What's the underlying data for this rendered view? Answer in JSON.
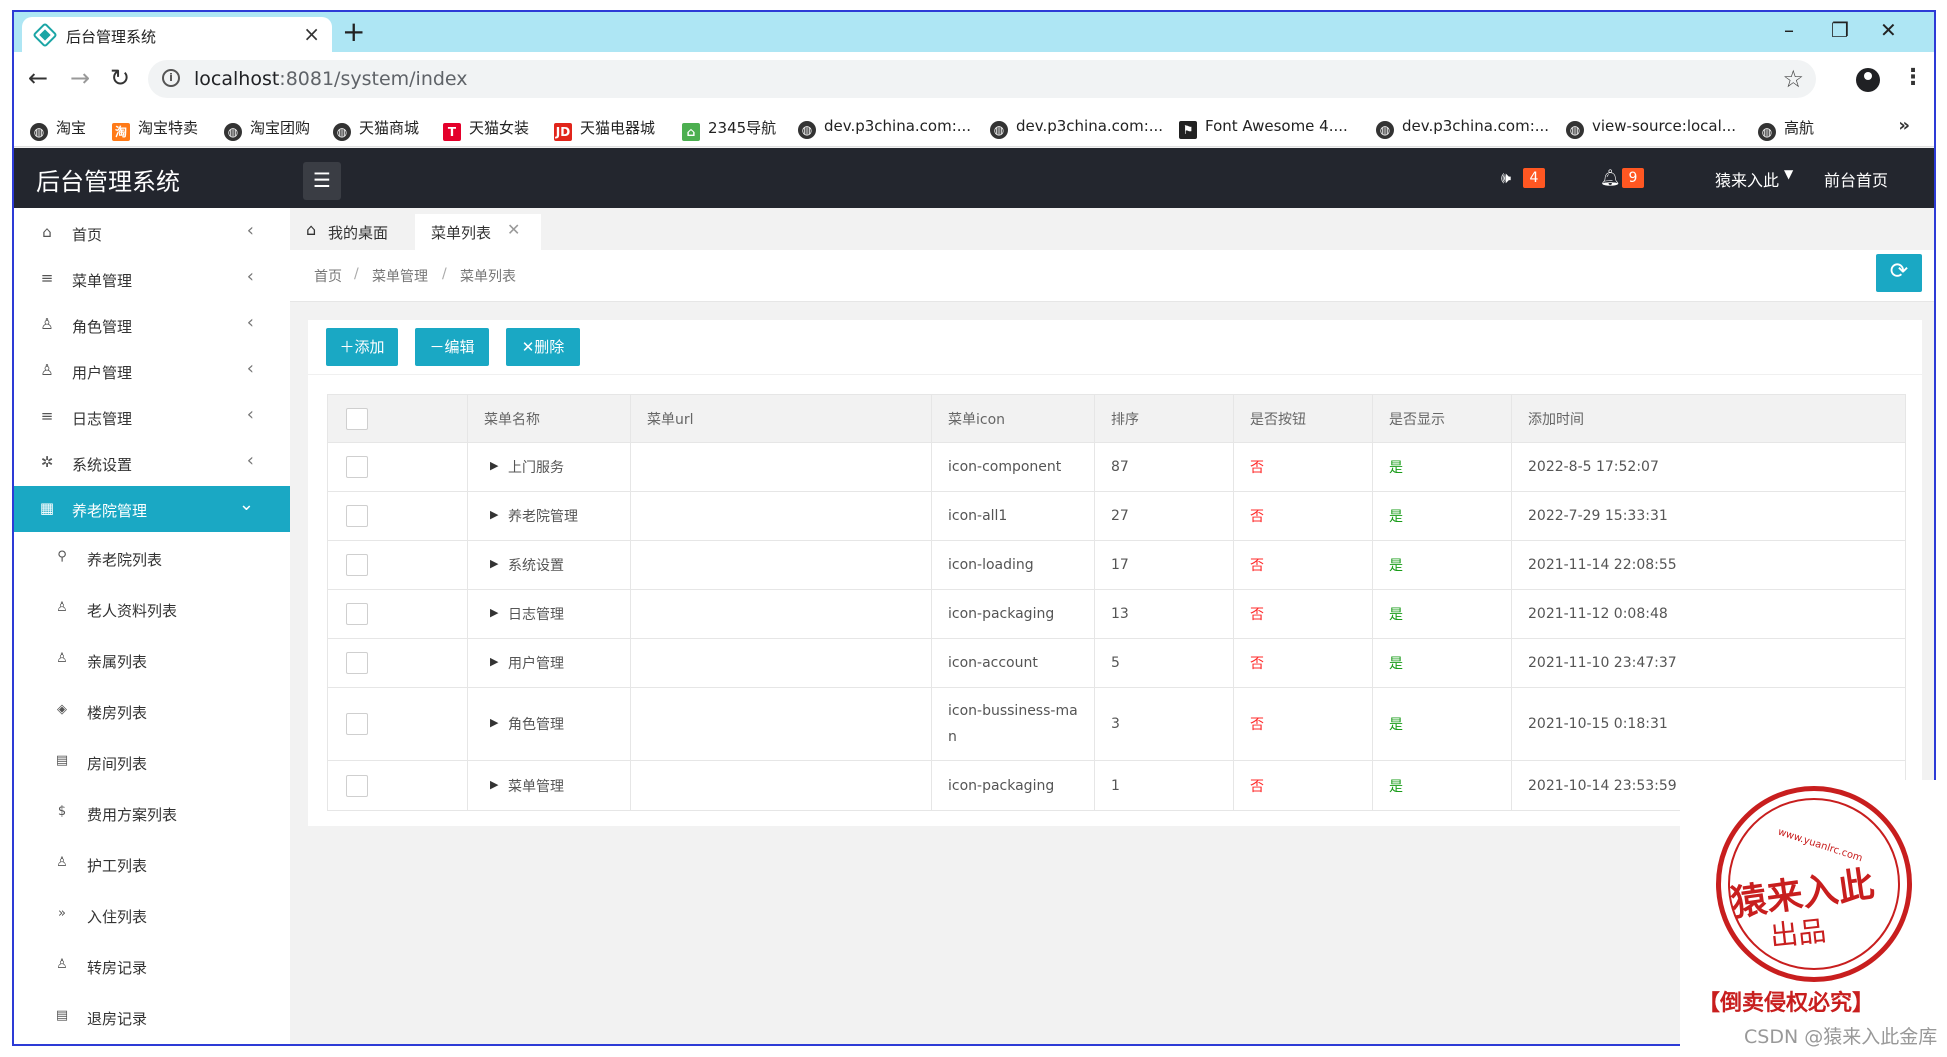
{
  "browser": {
    "tab_title": "后台管理系统",
    "tab_close": "×",
    "new_tab": "+",
    "url_host": "localhost",
    "url_rest": ":8081/system/index",
    "window_controls": [
      "–",
      "❐",
      "✕"
    ],
    "bookmarks": [
      {
        "label": "淘宝",
        "icon": "globe-icon"
      },
      {
        "label": "淘宝特卖",
        "icon": "taobao-sale-icon"
      },
      {
        "label": "淘宝团购",
        "icon": "globe-icon"
      },
      {
        "label": "天猫商城",
        "icon": "globe-icon"
      },
      {
        "label": "天猫女装",
        "icon": "tmall-icon"
      },
      {
        "label": "天猫电器城",
        "icon": "jd-icon"
      },
      {
        "label": "2345导航",
        "icon": "2345-icon"
      },
      {
        "label": "dev.p3china.com:...",
        "icon": "globe-icon"
      },
      {
        "label": "dev.p3china.com:...",
        "icon": "globe-icon"
      },
      {
        "label": "Font Awesome 4....",
        "icon": "flag-icon"
      },
      {
        "label": "dev.p3china.com:...",
        "icon": "globe-icon"
      },
      {
        "label": "view-source:local...",
        "icon": "globe-icon"
      },
      {
        "label": "高航",
        "icon": "globe-icon"
      }
    ],
    "bookmarks_more": "»"
  },
  "header": {
    "title": "后台管理系统",
    "notice_badge": "4",
    "bell_badge": "9",
    "user_name": "猿来入此",
    "front_link": "前台首页"
  },
  "sidebar": {
    "items": [
      {
        "label": "首页",
        "icon": "home-icon"
      },
      {
        "label": "菜单管理",
        "icon": "list-icon"
      },
      {
        "label": "角色管理",
        "icon": "user-icon"
      },
      {
        "label": "用户管理",
        "icon": "user-icon"
      },
      {
        "label": "日志管理",
        "icon": "list-icon"
      },
      {
        "label": "系统设置",
        "icon": "gear-icon"
      },
      {
        "label": "养老院管理",
        "icon": "grid-icon"
      }
    ],
    "sub_items": [
      {
        "label": "养老院列表",
        "icon": "pin-icon"
      },
      {
        "label": "老人资料列表",
        "icon": "user-icon"
      },
      {
        "label": "亲属列表",
        "icon": "user-icon"
      },
      {
        "label": "楼房列表",
        "icon": "layers-icon"
      },
      {
        "label": "房间列表",
        "icon": "room-icon"
      },
      {
        "label": "费用方案列表",
        "icon": "dollar-icon"
      },
      {
        "label": "护工列表",
        "icon": "user-icon"
      },
      {
        "label": "入住列表",
        "icon": "double-chevron-icon"
      },
      {
        "label": "转房记录",
        "icon": "user-icon"
      },
      {
        "label": "退房记录",
        "icon": "room-icon"
      }
    ]
  },
  "tabs": {
    "home": "我的桌面",
    "current": "菜单列表"
  },
  "breadcrumb": [
    "首页",
    "菜单管理",
    "菜单列表"
  ],
  "breadcrumb_sep": "/",
  "toolbar": {
    "add": "＋添加",
    "edit": "－编辑",
    "delete": "✕删除"
  },
  "table": {
    "headers": [
      "菜单名称",
      "菜单url",
      "菜单icon",
      "排序",
      "是否按钮",
      "是否显示",
      "添加时间"
    ],
    "rows": [
      {
        "name": "上门服务",
        "url": "",
        "icon": "icon-component",
        "sort": "87",
        "is_button": "否",
        "is_show": "是",
        "time": "2022-8-5 17:52:07"
      },
      {
        "name": "养老院管理",
        "url": "",
        "icon": "icon-all1",
        "sort": "27",
        "is_button": "否",
        "is_show": "是",
        "time": "2022-7-29 15:33:31"
      },
      {
        "name": "系统设置",
        "url": "",
        "icon": "icon-loading",
        "sort": "17",
        "is_button": "否",
        "is_show": "是",
        "time": "2021-11-14 22:08:55"
      },
      {
        "name": "日志管理",
        "url": "",
        "icon": "icon-packaging",
        "sort": "13",
        "is_button": "否",
        "is_show": "是",
        "time": "2021-11-12 0:08:48"
      },
      {
        "name": "用户管理",
        "url": "",
        "icon": "icon-account",
        "sort": "5",
        "is_button": "否",
        "is_show": "是",
        "time": "2021-11-10 23:47:37"
      },
      {
        "name": "角色管理",
        "url": "",
        "icon": "icon-bussiness-man",
        "sort": "3",
        "is_button": "否",
        "is_show": "是",
        "time": "2021-10-15 0:18:31"
      },
      {
        "name": "菜单管理",
        "url": "",
        "icon": "icon-packaging",
        "sort": "1",
        "is_button": "否",
        "is_show": "是",
        "time": "2021-10-14 23:53:59"
      }
    ]
  },
  "watermark": {
    "url": "www.yuanlrc.com",
    "main": "猿来入此",
    "sub": "出品",
    "banner": "【倒卖侵权必究】",
    "csdn": "CSDN @猿来入此金库"
  },
  "colors": {
    "accent": "#1aa8c4",
    "header_bg": "#23262e",
    "badge": "#ff5722",
    "no": "#ff2a2a",
    "yes": "#1a9c1a",
    "stamp": "#c81e1e"
  }
}
